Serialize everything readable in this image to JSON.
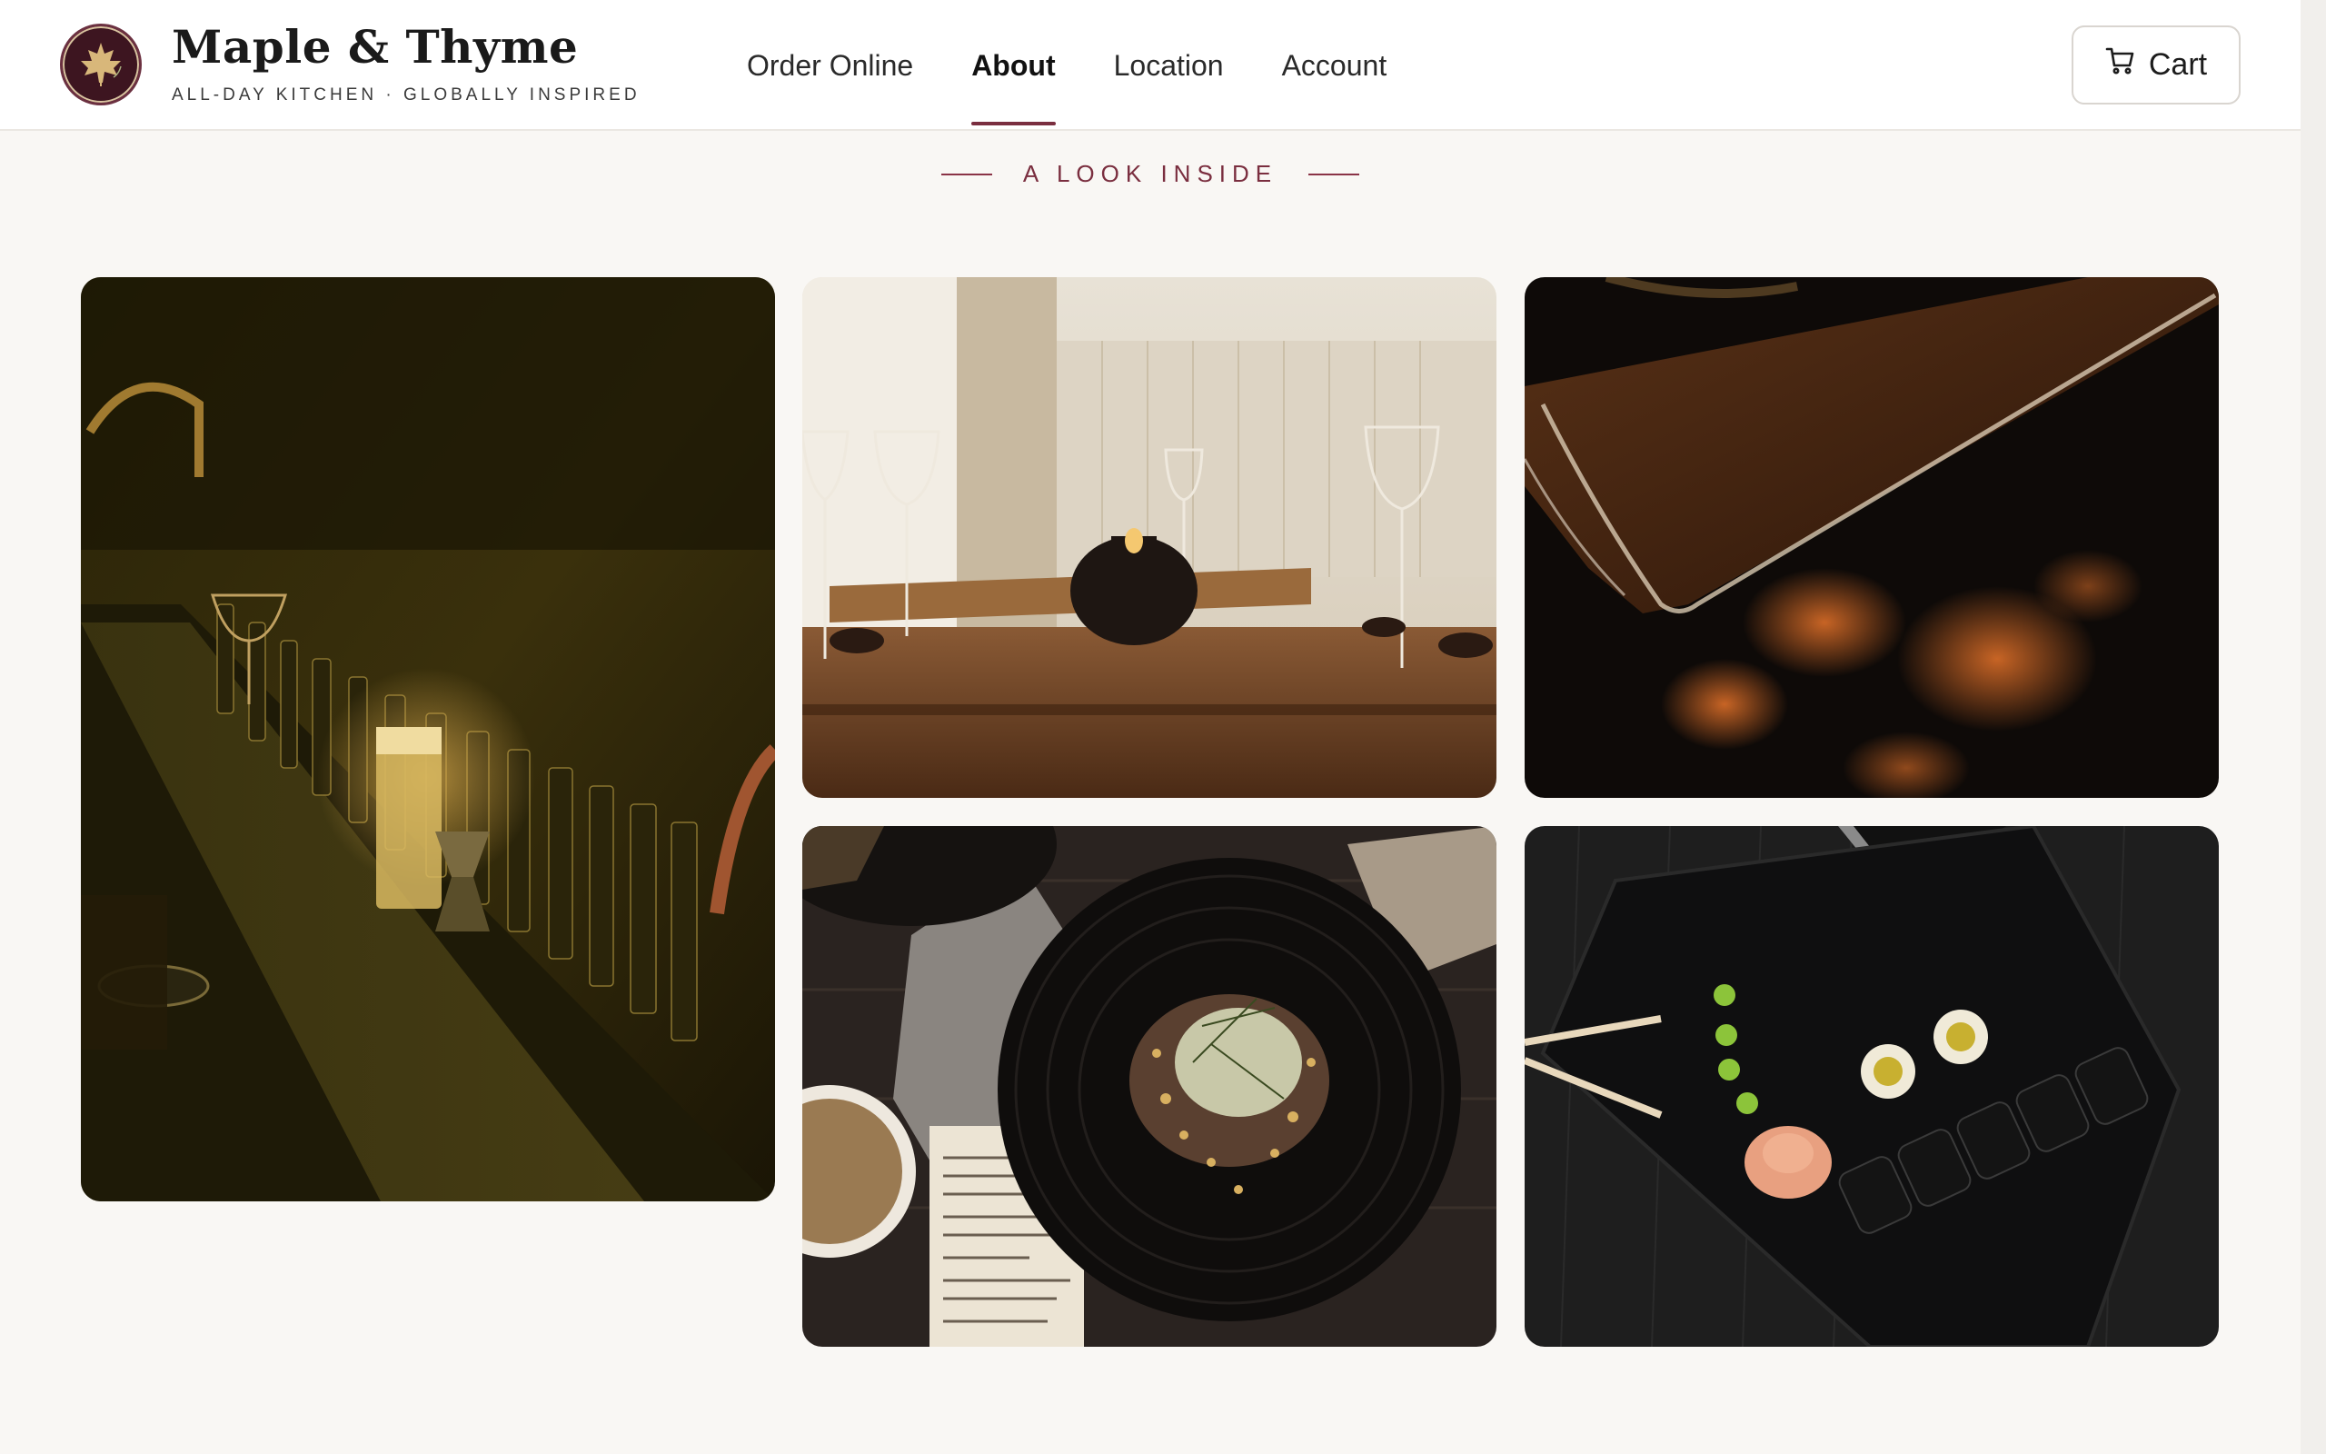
{
  "brand": {
    "name": "Maple & Thyme",
    "tagline": "ALL-DAY KITCHEN · GLOBALLY INSPIRED",
    "logo_icon": "maple-leaf-icon"
  },
  "nav": {
    "items": [
      {
        "label": "Order Online",
        "active": false
      },
      {
        "label": "About",
        "active": true
      },
      {
        "label": "Location",
        "active": false
      },
      {
        "label": "Account",
        "active": false
      }
    ]
  },
  "cart": {
    "label": "Cart",
    "icon": "cart-icon"
  },
  "section": {
    "eyebrow": "A LOOK INSIDE"
  },
  "colors": {
    "accent": "#7a2e3f",
    "logo_bg": "#3d1520",
    "page_bg": "#f9f7f4"
  }
}
